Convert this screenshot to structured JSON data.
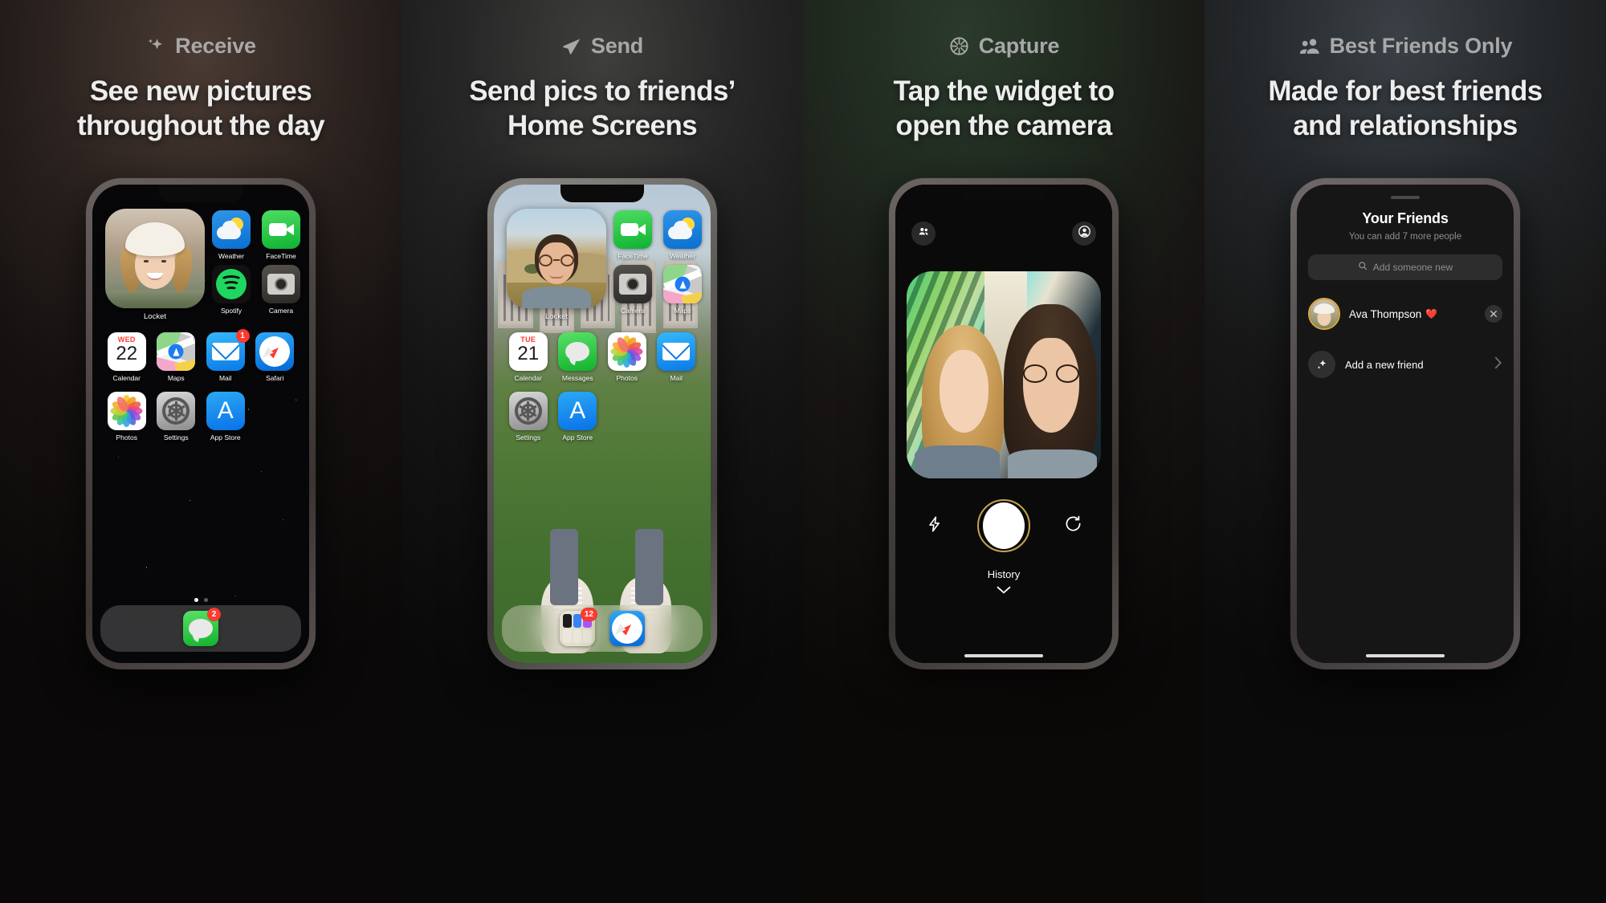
{
  "panels": [
    {
      "eyebrow": "Receive",
      "eyebrow_icon": "sparkle-icon",
      "headline_line1": "See new pictures",
      "headline_line2": "throughout the day",
      "phone": {
        "type": "home-screen",
        "widget_label": "Locket",
        "apps": [
          {
            "label": "Weather",
            "icon": "weather-icon",
            "badge": ""
          },
          {
            "label": "FaceTime",
            "icon": "facetime-icon",
            "badge": ""
          },
          {
            "label": "Spotify",
            "icon": "spotify-icon",
            "badge": ""
          },
          {
            "label": "Camera",
            "icon": "camera-icon",
            "badge": ""
          },
          {
            "label": "Calendar",
            "icon": "calendar-icon",
            "badge": "",
            "cal_dow": "WED",
            "cal_day": "22"
          },
          {
            "label": "Maps",
            "icon": "maps-icon",
            "badge": ""
          },
          {
            "label": "Mail",
            "icon": "mail-icon",
            "badge": "1"
          },
          {
            "label": "Safari",
            "icon": "safari-icon",
            "badge": ""
          },
          {
            "label": "Photos",
            "icon": "photos-icon",
            "badge": ""
          },
          {
            "label": "Settings",
            "icon": "settings-icon",
            "badge": ""
          },
          {
            "label": "App Store",
            "icon": "app-store-icon",
            "badge": ""
          }
        ],
        "dock": [
          {
            "label": "Messages",
            "icon": "messages-icon",
            "badge": "2"
          }
        ],
        "page_dots": 2,
        "active_dot": 0
      }
    },
    {
      "eyebrow": "Send",
      "eyebrow_icon": "paper-plane-icon",
      "headline_line1": "Send pics to friends’",
      "headline_line2": "Home Screens",
      "phone": {
        "type": "home-screen",
        "widget_label": "Locket",
        "apps": [
          {
            "label": "FaceTime",
            "icon": "facetime-icon",
            "badge": ""
          },
          {
            "label": "Weather",
            "icon": "weather-icon",
            "badge": ""
          },
          {
            "label": "Camera",
            "icon": "camera-icon",
            "badge": ""
          },
          {
            "label": "Maps",
            "icon": "maps-icon",
            "badge": ""
          },
          {
            "label": "Calendar",
            "icon": "calendar-icon",
            "badge": "",
            "cal_dow": "TUE",
            "cal_day": "21"
          },
          {
            "label": "Messages",
            "icon": "messages-icon",
            "badge": ""
          },
          {
            "label": "Photos",
            "icon": "photos-icon",
            "badge": ""
          },
          {
            "label": "Mail",
            "icon": "mail-icon",
            "badge": ""
          },
          {
            "label": "Settings",
            "icon": "settings-icon",
            "badge": ""
          },
          {
            "label": "App Store",
            "icon": "app-store-icon",
            "badge": ""
          }
        ],
        "dock": [
          {
            "label": "",
            "icon": "app-folder-icon",
            "badge": "12"
          },
          {
            "label": "",
            "icon": "safari-icon",
            "badge": ""
          }
        ]
      }
    },
    {
      "eyebrow": "Capture",
      "eyebrow_icon": "aperture-icon",
      "headline_line1": "Tap the widget to",
      "headline_line2": "open the camera",
      "phone": {
        "type": "camera",
        "top_left_icon": "friends-icon",
        "top_right_icon": "profile-icon",
        "flash_icon": "flash-icon",
        "flip_icon": "flip-camera-icon",
        "shutter_label": "shutter-button",
        "history_label": "History",
        "history_chevron": "chevron-down-icon"
      }
    },
    {
      "eyebrow": "Best Friends Only",
      "eyebrow_icon": "people-icon",
      "headline_line1": "Made for best friends",
      "headline_line2": "and relationships",
      "phone": {
        "type": "friends",
        "title": "Your Friends",
        "subtitle": "You can add 7 more people",
        "search_placeholder": "Add someone new",
        "search_icon": "search-icon",
        "friends": [
          {
            "name": "Ava Thompson",
            "emoji": "❤️",
            "remove_icon": "close-icon"
          }
        ],
        "add_friend_label": "Add a new friend",
        "add_friend_icon": "sparkle-icon",
        "add_friend_chevron": "chevron-right-icon"
      }
    }
  ],
  "colors": {
    "accent_gold": "#c8a24e",
    "badge_red": "#ff3b30",
    "eyebrow_gray": "#a8a8a8",
    "headline_white": "#ededed"
  }
}
